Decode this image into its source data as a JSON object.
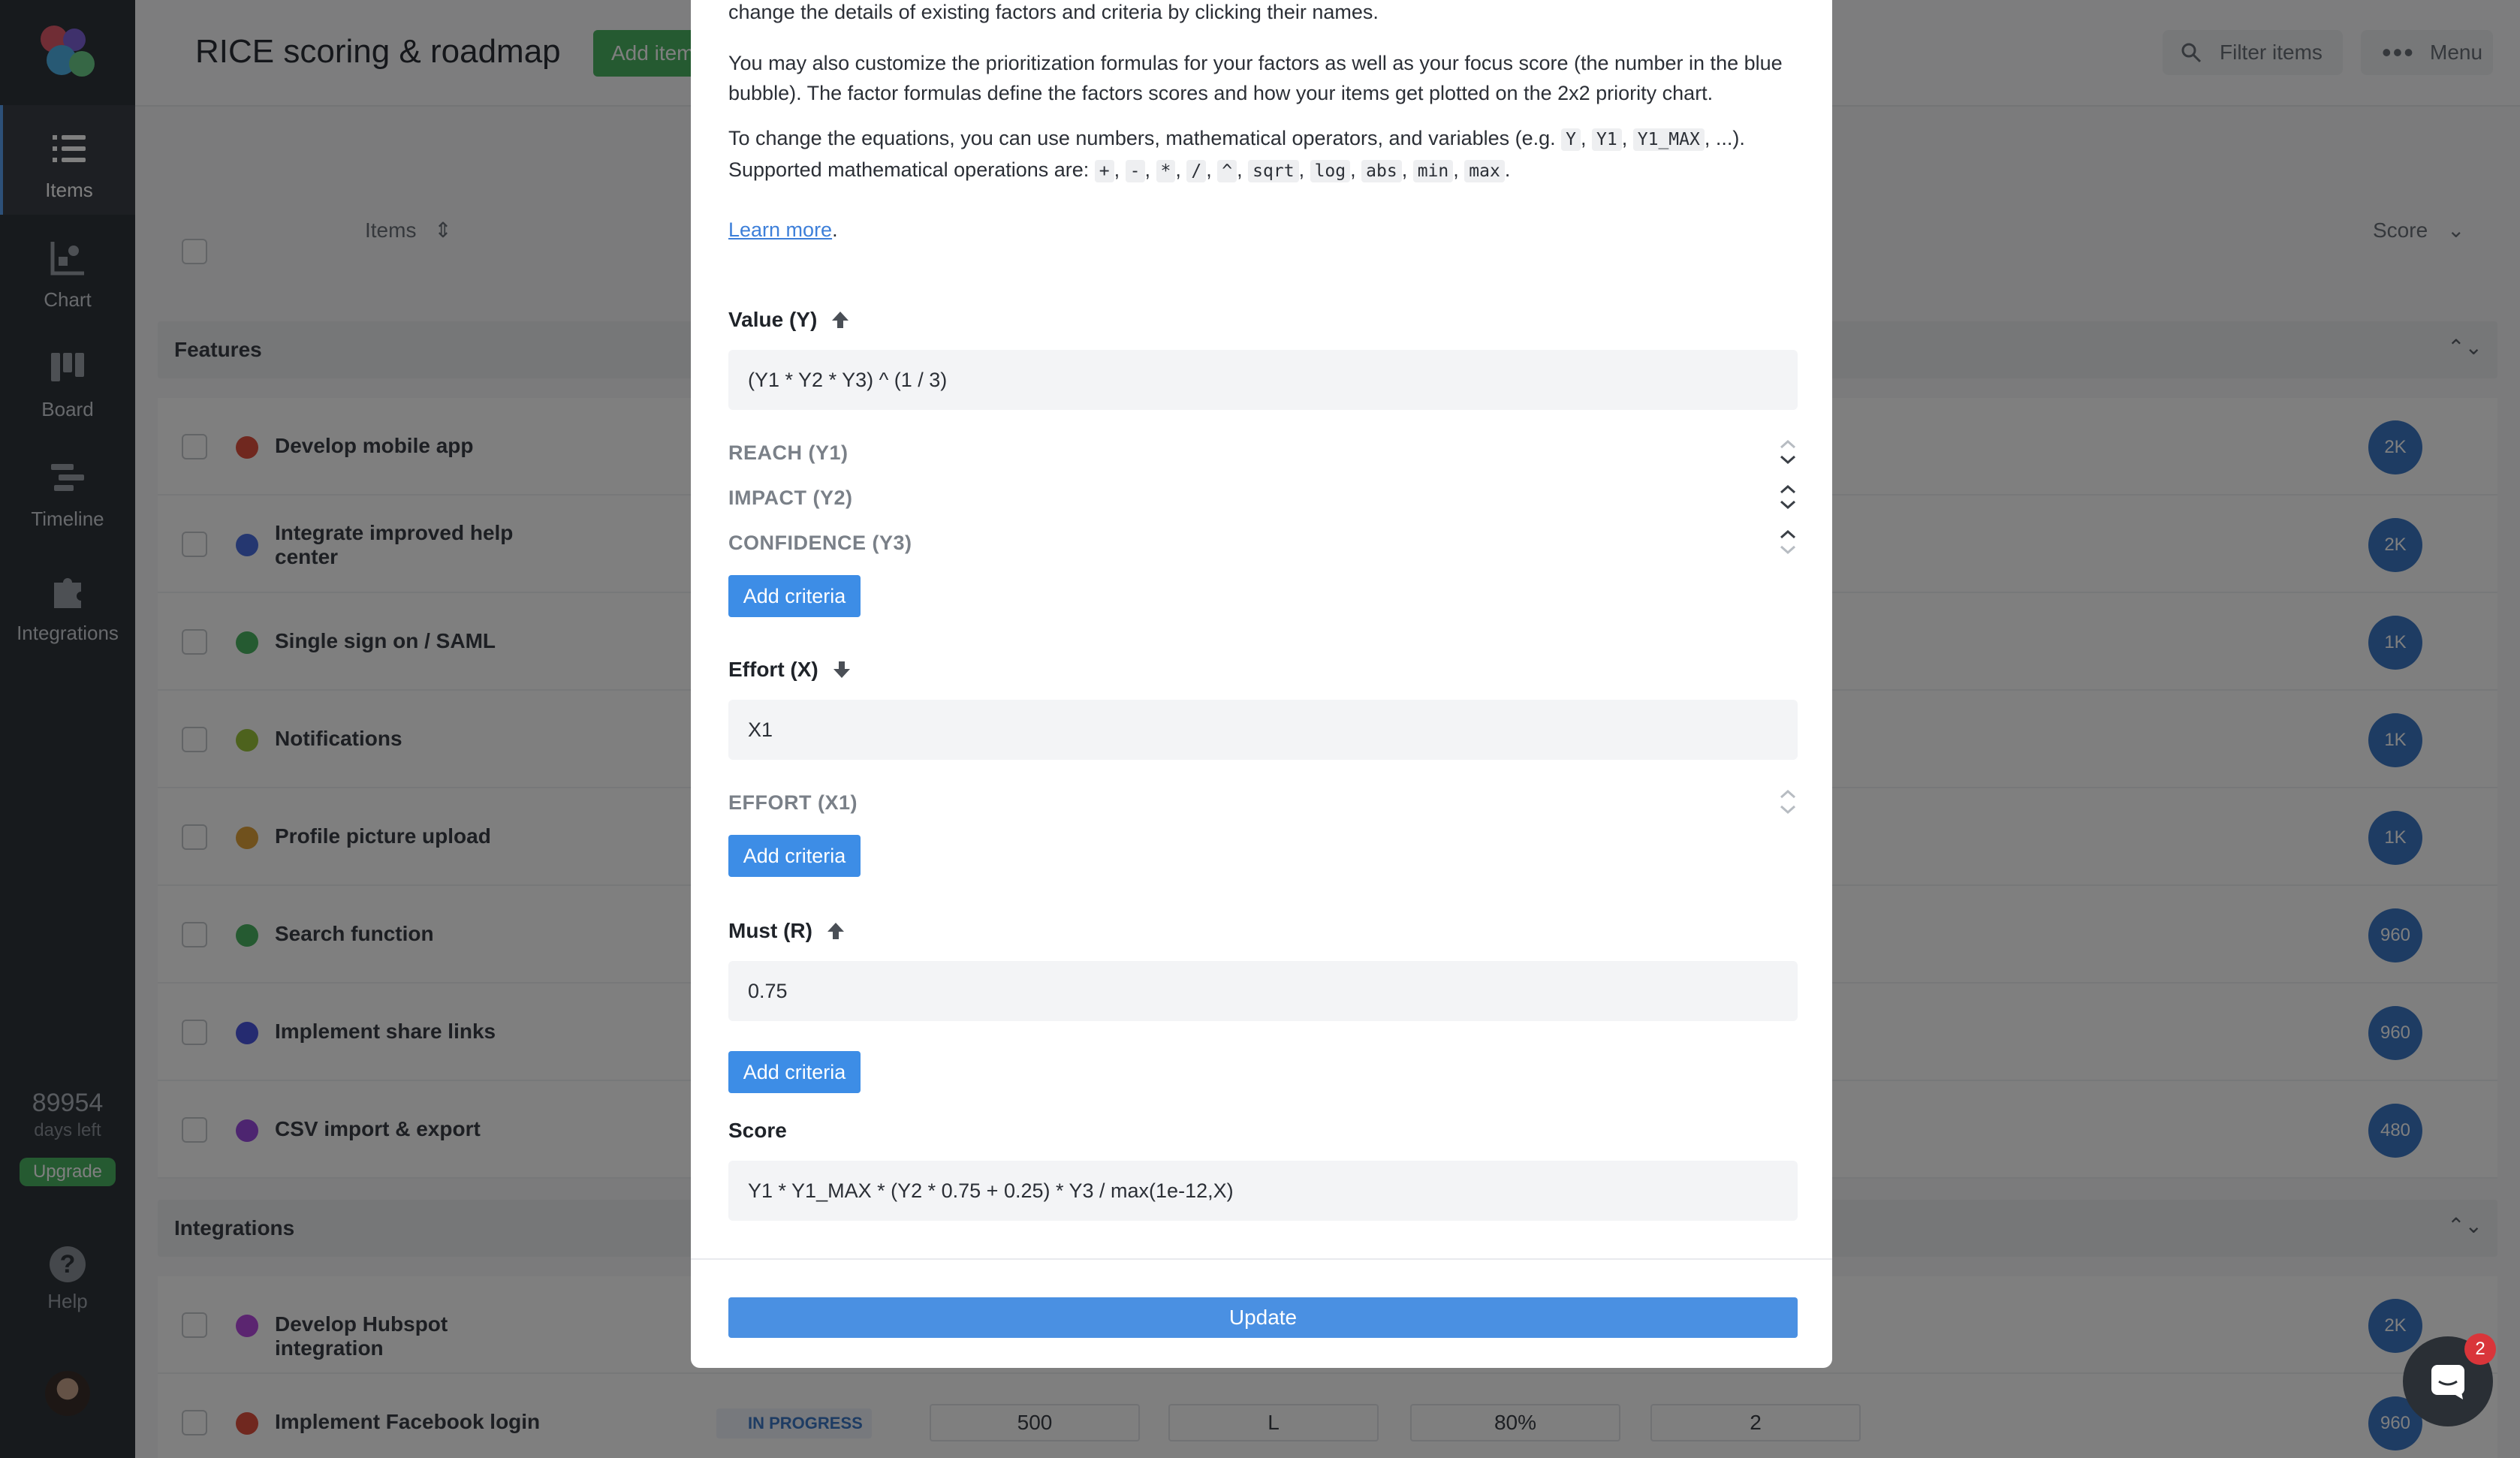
{
  "app": {
    "title": "RICE scoring & roadmap",
    "add_item_label": "Add item",
    "filter_label": "Filter items",
    "menu_label": "Menu"
  },
  "sidebar": {
    "items": [
      {
        "label": "Items",
        "icon": "list-icon",
        "active": true
      },
      {
        "label": "Chart",
        "icon": "chart-icon",
        "active": false
      },
      {
        "label": "Board",
        "icon": "board-icon",
        "active": false
      },
      {
        "label": "Timeline",
        "icon": "timeline-icon",
        "active": false
      },
      {
        "label": "Integrations",
        "icon": "puzzle-icon",
        "active": false
      }
    ],
    "days_left_value": "89954",
    "days_left_label": "days left",
    "upgrade_label": "Upgrade",
    "help_label": "Help"
  },
  "table": {
    "items_header": "Items",
    "score_header": "Score",
    "groups": [
      {
        "name": "Features",
        "rows": [
          {
            "name": "Develop mobile app",
            "color": "#e0513f",
            "score": "2K"
          },
          {
            "name": "Integrate improved help center",
            "color": "#4a6fe0",
            "score": "2K"
          },
          {
            "name": "Single sign on / SAML",
            "color": "#4bb462",
            "score": "1K"
          },
          {
            "name": "Notifications",
            "color": "#9bc43a",
            "score": "1K"
          },
          {
            "name": "Profile picture upload",
            "color": "#e0a23a",
            "score": "1K"
          },
          {
            "name": "Search function",
            "color": "#4bb462",
            "score": "960"
          },
          {
            "name": "Implement share links",
            "color": "#4a56e0",
            "score": "960"
          },
          {
            "name": "CSV import & export",
            "color": "#9a4ae0",
            "score": "480"
          }
        ]
      },
      {
        "name": "Integrations",
        "rows": [
          {
            "name": "Develop Hubspot integration",
            "color": "#b64ae0",
            "score": "2K"
          },
          {
            "name": "Implement Facebook login",
            "color": "#e0513f",
            "score": "960",
            "status": "IN PROGRESS",
            "cells": [
              "500",
              "L",
              "80%",
              "2"
            ]
          }
        ]
      }
    ]
  },
  "modal": {
    "intro_tail": "change the details of existing factors and criteria by clicking their names.",
    "para2": "You may also customize the prioritization formulas for your factors as well as your focus score (the number in the blue bubble). The factor formulas define the factors scores and how your items get plotted on the 2x2 priority chart.",
    "para3_prefix": "To change the equations, you can use numbers, mathematical operators, and variables (e.g.",
    "para3_vars": [
      "Y",
      "Y1",
      "Y1_MAX"
    ],
    "para3_suffix": ", ...).",
    "para3_line2_prefix": "Supported mathematical operations are:",
    "operators": [
      "+",
      "-",
      "*",
      "/",
      "^",
      "sqrt",
      "log",
      "abs",
      "min",
      "max"
    ],
    "learn_more": "Learn more",
    "factors": [
      {
        "title": "Value (Y)",
        "direction": "up",
        "formula": "(Y1 * Y2 * Y3) ^ (1 / 3)",
        "criteria": [
          "REACH (Y1)",
          "IMPACT (Y2)",
          "CONFIDENCE (Y3)"
        ]
      },
      {
        "title": "Effort (X)",
        "direction": "down",
        "formula": "X1",
        "criteria": [
          "EFFORT (X1)"
        ]
      },
      {
        "title": "Must (R)",
        "direction": "up",
        "formula": "0.75",
        "criteria": []
      }
    ],
    "add_criteria_label": "Add criteria",
    "score_title": "Score",
    "score_formula": "Y1 * Y1_MAX * (Y2 * 0.75 + 0.25) * Y3 / max(1e-12,X)",
    "update_label": "Update"
  },
  "chat": {
    "badge_count": "2"
  }
}
